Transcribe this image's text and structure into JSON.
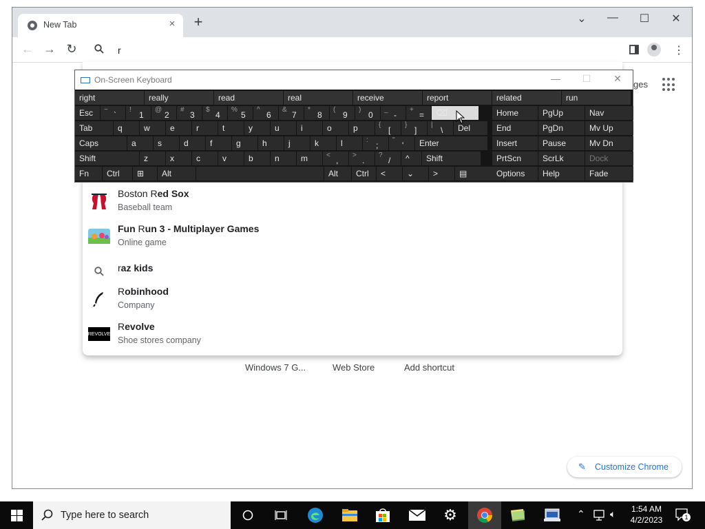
{
  "browser": {
    "tab_title": "New Tab",
    "tab_close": "×",
    "new_tab": "+",
    "omnibox_value": "r",
    "window_controls": [
      "⌄",
      "—",
      "☐",
      "✕"
    ],
    "images_link": "ges",
    "icons": [
      "chrome-icon",
      "back-icon",
      "forward-icon",
      "reload-icon",
      "search-icon",
      "side-panel-icon",
      "profile-icon",
      "menu-icon",
      "apps-icon"
    ]
  },
  "suggestions": [
    {
      "match": "R",
      "rest_before": "Boston ",
      "rest": "ed Sox",
      "sub": "Baseball team",
      "icon": "red-sox-logo-icon"
    },
    {
      "match": "R",
      "rest_before": "Fun ",
      "rest": "un 3 - Multiplayer Games",
      "sub": "Online game",
      "icon": "game-thumbnail-icon"
    },
    {
      "match": "r",
      "rest_before": "",
      "rest": "az kids",
      "sub": "",
      "icon": "search-icon"
    },
    {
      "match": "R",
      "rest_before": "",
      "rest": "obinhood",
      "sub": "Company",
      "icon": "robinhood-logo-icon"
    },
    {
      "match": "R",
      "rest_before": "",
      "rest": "evolve",
      "sub": "Shoe stores company",
      "icon": "revolve-logo-icon"
    }
  ],
  "revolve_logo_text": "REVOLVE",
  "shortcuts": [
    "Windows 7 G...",
    "Web Store",
    "Add shortcut"
  ],
  "customize_label": "Customize Chrome",
  "osk": {
    "title": "On-Screen Keyboard",
    "title_buttons": [
      "—",
      "☐",
      "✕"
    ],
    "predictions": [
      "right",
      "really",
      "read",
      "real",
      "receive",
      "report",
      "related",
      "run"
    ],
    "row1": [
      {
        "main": "Esc"
      },
      {
        "shift": "~",
        "main": "`"
      },
      {
        "shift": "!",
        "main": "1"
      },
      {
        "shift": "@",
        "main": "2"
      },
      {
        "shift": "#",
        "main": "3"
      },
      {
        "shift": "$",
        "main": "4"
      },
      {
        "shift": "%",
        "main": "5"
      },
      {
        "shift": "^",
        "main": "6"
      },
      {
        "shift": "&",
        "main": "7"
      },
      {
        "shift": "*",
        "main": "8"
      },
      {
        "shift": "(",
        "main": "9"
      },
      {
        "shift": ")",
        "main": "0"
      },
      {
        "shift": "_",
        "main": "-"
      },
      {
        "shift": "+",
        "main": "="
      },
      {
        "main": "⌫"
      }
    ],
    "row2": [
      {
        "main": "Tab"
      },
      {
        "main": "q"
      },
      {
        "main": "w"
      },
      {
        "main": "e"
      },
      {
        "main": "r"
      },
      {
        "main": "t"
      },
      {
        "main": "y"
      },
      {
        "main": "u"
      },
      {
        "main": "i"
      },
      {
        "main": "o"
      },
      {
        "main": "p"
      },
      {
        "shift": "{",
        "main": "["
      },
      {
        "shift": "}",
        "main": "]"
      },
      {
        "shift": "|",
        "main": "\\"
      },
      {
        "main": "Del"
      }
    ],
    "row3": [
      {
        "main": "Caps"
      },
      {
        "main": "a"
      },
      {
        "main": "s"
      },
      {
        "main": "d"
      },
      {
        "main": "f"
      },
      {
        "main": "g"
      },
      {
        "main": "h"
      },
      {
        "main": "j"
      },
      {
        "main": "k"
      },
      {
        "main": "l"
      },
      {
        "shift": ":",
        "main": ";"
      },
      {
        "shift": "\"",
        "main": "'"
      },
      {
        "main": "Enter"
      }
    ],
    "row4": [
      {
        "main": "Shift"
      },
      {
        "main": "z"
      },
      {
        "main": "x"
      },
      {
        "main": "c"
      },
      {
        "main": "v"
      },
      {
        "main": "b"
      },
      {
        "main": "n"
      },
      {
        "main": "m"
      },
      {
        "shift": "<",
        "main": ","
      },
      {
        "shift": ">",
        "main": "."
      },
      {
        "shift": "?",
        "main": "/"
      },
      {
        "main": "^"
      },
      {
        "main": "Shift"
      }
    ],
    "row5": [
      {
        "main": "Fn"
      },
      {
        "main": "Ctrl"
      },
      {
        "main": "⊞"
      },
      {
        "main": "Alt"
      },
      {
        "main": ""
      },
      {
        "main": "Alt"
      },
      {
        "main": "Ctrl"
      },
      {
        "main": "<"
      },
      {
        "main": "⌄"
      },
      {
        "main": ">"
      },
      {
        "main": "▤"
      }
    ],
    "right_keys": [
      [
        "Home",
        "PgUp",
        "Nav"
      ],
      [
        "End",
        "PgDn",
        "Mv Up"
      ],
      [
        "Insert",
        "Pause",
        "Mv Dn"
      ],
      [
        "PrtScn",
        "ScrLk",
        "Dock"
      ],
      [
        "Options",
        "Help",
        "Fade"
      ]
    ]
  },
  "taskbar": {
    "search_placeholder": "Type here to search",
    "time": "1:54 AM",
    "date": "4/2/2023",
    "notification_count": "1",
    "icons": [
      "start-icon",
      "cortana-icon",
      "task-view-icon",
      "edge-icon",
      "file-explorer-icon",
      "store-icon",
      "mail-icon",
      "settings-icon",
      "chrome-icon",
      "sticky-notes-icon",
      "osk-icon",
      "tray-chevron-icon",
      "network-icon",
      "volume-icon",
      "notification-icon"
    ]
  }
}
